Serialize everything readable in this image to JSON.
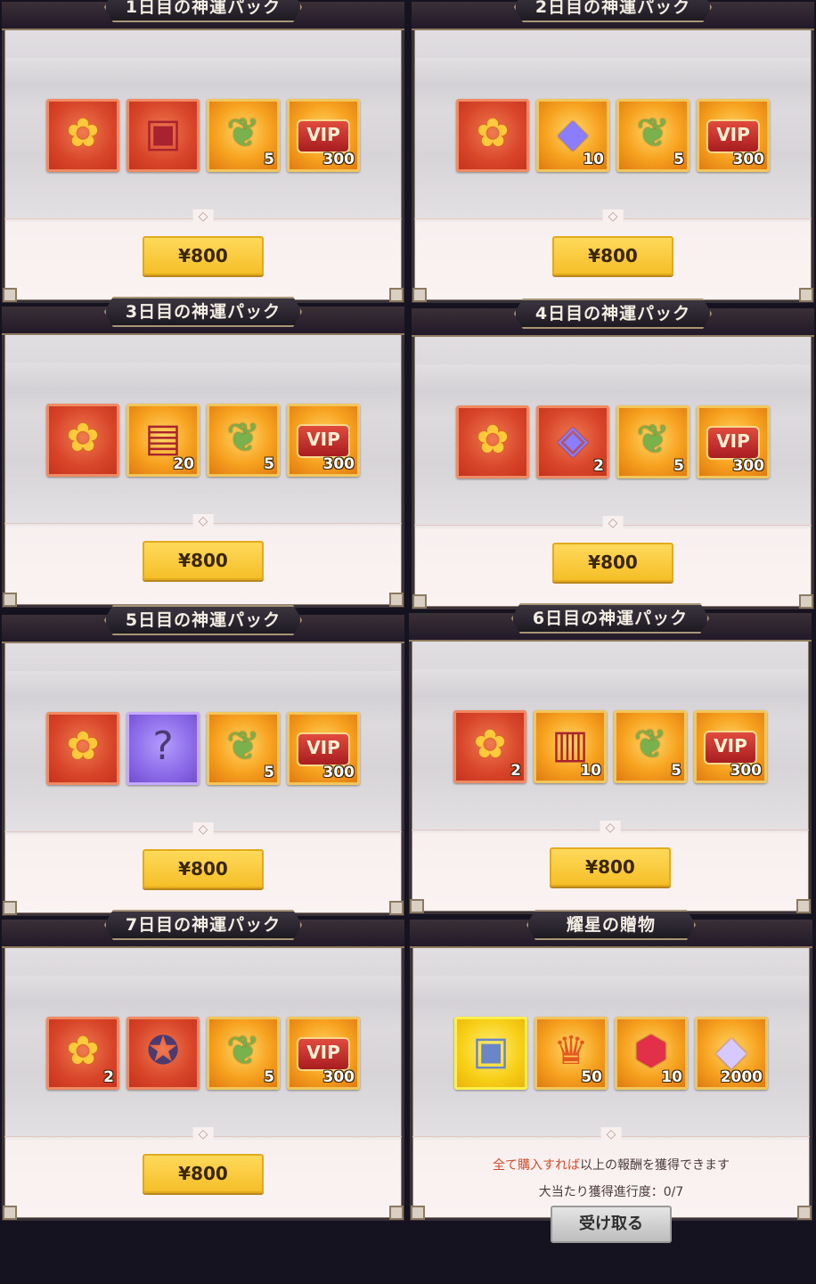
{
  "currency_price": "¥800",
  "packs": [
    {
      "title": "1日目の神運パック",
      "items": [
        {
          "icon": "golden-flower-icon",
          "bg": "red",
          "count": ""
        },
        {
          "icon": "red-chest-icon",
          "bg": "red",
          "count": ""
        },
        {
          "icon": "green-leaf-icon",
          "bg": "orange",
          "count": "5"
        },
        {
          "icon": "vip-badge-icon",
          "bg": "orange",
          "count": "300"
        }
      ]
    },
    {
      "title": "2日目の神運パック",
      "items": [
        {
          "icon": "golden-flower-icon",
          "bg": "red",
          "count": ""
        },
        {
          "icon": "crystal-ring-icon",
          "bg": "orange",
          "count": "10"
        },
        {
          "icon": "green-leaf-icon",
          "bg": "orange",
          "count": "5"
        },
        {
          "icon": "vip-badge-icon",
          "bg": "orange",
          "count": "300"
        }
      ]
    },
    {
      "title": "3日目の神運パック",
      "items": [
        {
          "icon": "golden-flower-icon",
          "bg": "red",
          "count": ""
        },
        {
          "icon": "supply-crate-icon",
          "bg": "orange",
          "count": "20"
        },
        {
          "icon": "green-leaf-icon",
          "bg": "orange",
          "count": "5"
        },
        {
          "icon": "vip-badge-icon",
          "bg": "orange",
          "count": "300"
        }
      ]
    },
    {
      "title": "4日目の神運パック",
      "items": [
        {
          "icon": "golden-flower-icon",
          "bg": "red",
          "count": ""
        },
        {
          "icon": "blue-cube-icon",
          "bg": "red",
          "count": "2"
        },
        {
          "icon": "green-leaf-icon",
          "bg": "orange",
          "count": "5"
        },
        {
          "icon": "vip-badge-icon",
          "bg": "orange",
          "count": "300"
        }
      ]
    },
    {
      "title": "5日目の神運パック",
      "items": [
        {
          "icon": "golden-flower-icon",
          "bg": "red",
          "count": ""
        },
        {
          "icon": "mystery-box-icon",
          "bg": "purple",
          "count": ""
        },
        {
          "icon": "green-leaf-icon",
          "bg": "orange",
          "count": "5"
        },
        {
          "icon": "vip-badge-icon",
          "bg": "orange",
          "count": "300"
        }
      ]
    },
    {
      "title": "6日目の神運パック",
      "items": [
        {
          "icon": "golden-flower-icon",
          "bg": "red",
          "count": "2"
        },
        {
          "icon": "treasure-chest-icon",
          "bg": "orange",
          "count": "10"
        },
        {
          "icon": "green-leaf-icon",
          "bg": "orange",
          "count": "5"
        },
        {
          "icon": "vip-badge-icon",
          "bg": "orange",
          "count": "300"
        }
      ]
    },
    {
      "title": "7日目の神運パック",
      "items": [
        {
          "icon": "golden-flower-icon",
          "bg": "red",
          "count": "2"
        },
        {
          "icon": "hero-chest-icon",
          "bg": "red",
          "count": ""
        },
        {
          "icon": "green-leaf-icon",
          "bg": "orange",
          "count": "5"
        },
        {
          "icon": "vip-badge-icon",
          "bg": "orange",
          "count": "300"
        }
      ]
    }
  ],
  "gift": {
    "title": "耀星の贈物",
    "items": [
      {
        "icon": "silver-chest-icon",
        "bg": "gold",
        "count": ""
      },
      {
        "icon": "star-crown-icon",
        "bg": "orange",
        "count": "50"
      },
      {
        "icon": "ruby-gem-icon",
        "bg": "orange",
        "count": "10"
      },
      {
        "icon": "diamond-icon",
        "bg": "orange",
        "count": "2000"
      }
    ],
    "notice_highlight": "全て購入すれば",
    "notice_rest": "以上の報酬を獲得できます",
    "progress": "大当たり獲得進行度：0/7",
    "claim_label": "受け取る"
  },
  "vip_text": "VIP"
}
